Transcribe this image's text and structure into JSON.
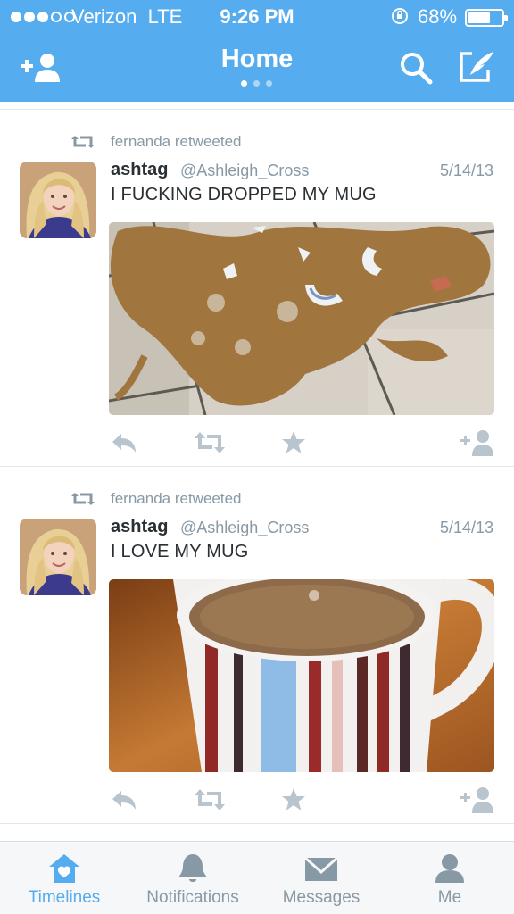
{
  "status_bar": {
    "carrier": "Verizon",
    "network": "LTE",
    "time": "9:26 PM",
    "battery_percent": "68%",
    "battery_level": 0.68,
    "signal_bars_filled": 3,
    "signal_bars_total": 5
  },
  "nav": {
    "title": "Home",
    "page_dots": 3,
    "active_page": 1,
    "left_icon": "add-user-icon",
    "right_icons": [
      "search-icon",
      "compose-icon"
    ]
  },
  "colors": {
    "brand": "#55acee",
    "muted": "#8899a6",
    "text": "#292f33"
  },
  "tweets": [
    {
      "retweet_text": "fernanda retweeted",
      "name": "ashtag",
      "handle": "@Ashleigh_Cross",
      "date": "5/14/13",
      "text": "I FUCKING DROPPED MY MUG",
      "media": "photo of a broken mug and spilled coffee on a tiled floor"
    },
    {
      "retweet_text": "fernanda retweeted",
      "name": "ashtag",
      "handle": "@Ashleigh_Cross",
      "date": "5/14/13",
      "text": "I LOVE MY MUG",
      "media": "photo of a striped mug full of coffee on a wooden table"
    }
  ],
  "tabs": [
    {
      "label": "Timelines",
      "icon": "home-icon",
      "active": true
    },
    {
      "label": "Notifications",
      "icon": "bell-icon",
      "active": false
    },
    {
      "label": "Messages",
      "icon": "envelope-icon",
      "active": false
    },
    {
      "label": "Me",
      "icon": "person-icon",
      "active": false
    }
  ]
}
